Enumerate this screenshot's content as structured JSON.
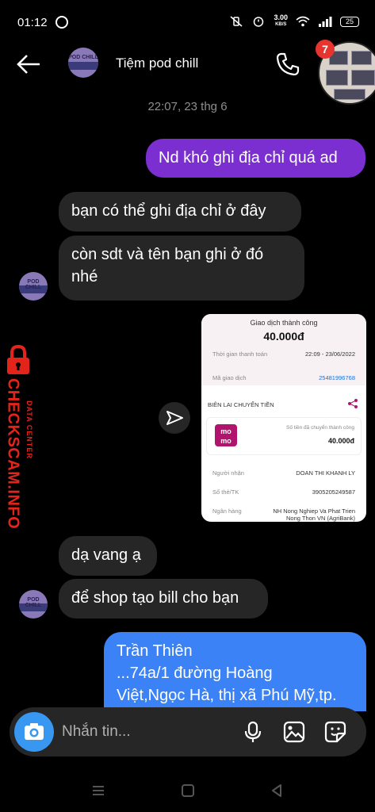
{
  "status": {
    "time": "01:12",
    "speed_value": "3.00",
    "speed_unit": "KB/S",
    "battery": "25"
  },
  "header": {
    "chat_name": "Tiệm pod chill"
  },
  "float_badge": "7",
  "avatar_text": "POD CHILL",
  "messages": {
    "date": "22:07, 23 thg 6",
    "out1": "Nd khó ghi địa chỉ quá ad",
    "in1": "bạn có thể ghi địa chỉ ở đây",
    "in2": "còn sdt và tên bạn ghi ở đó nhé",
    "in3": "dạ vang ạ",
    "in4": "để shop tạo bill cho bạn",
    "blue_lines": [
      "Trần Thiên",
      "...74a/1 đường Hoàng",
      "Việt,Ngọc Hà, thị xã Phú Mỹ,tp."
    ]
  },
  "receipt": {
    "title": "Giao dịch thành công",
    "amount": "40.000đ",
    "time_label": "Thời gian thanh toán",
    "time_value": "22:09 - 23/06/2022",
    "code_label": "Mã giao dịch",
    "code_value": "25481996768",
    "section": "BIÊN LAI CHUYỂN TIỀN",
    "brand_line1": "mo",
    "brand_line2": "mo",
    "card_label": "Số tiền đã chuyển thành công",
    "card_amount": "40.000đ",
    "receiver_label": "Người nhận",
    "receiver_value": "DOAN THI KHANH LY",
    "account_label": "Số thẻ/TK",
    "account_value": "3905205249587",
    "bank_label": "Ngân hàng",
    "bank_value": "NH Nong Nghiep Va Phat Trien",
    "bank_value2": "Nong Thon VN (AgriBank)"
  },
  "watermark": {
    "main": "CHECKSCAM.INFO",
    "sub": "DATA CENTER"
  },
  "composer": {
    "placeholder": "Nhắn tin..."
  },
  "colors": {
    "outgoing": "#7b2fd0",
    "incoming": "#262626",
    "blue_bubble": "#3b82f6",
    "watermark": "#e3241b"
  }
}
